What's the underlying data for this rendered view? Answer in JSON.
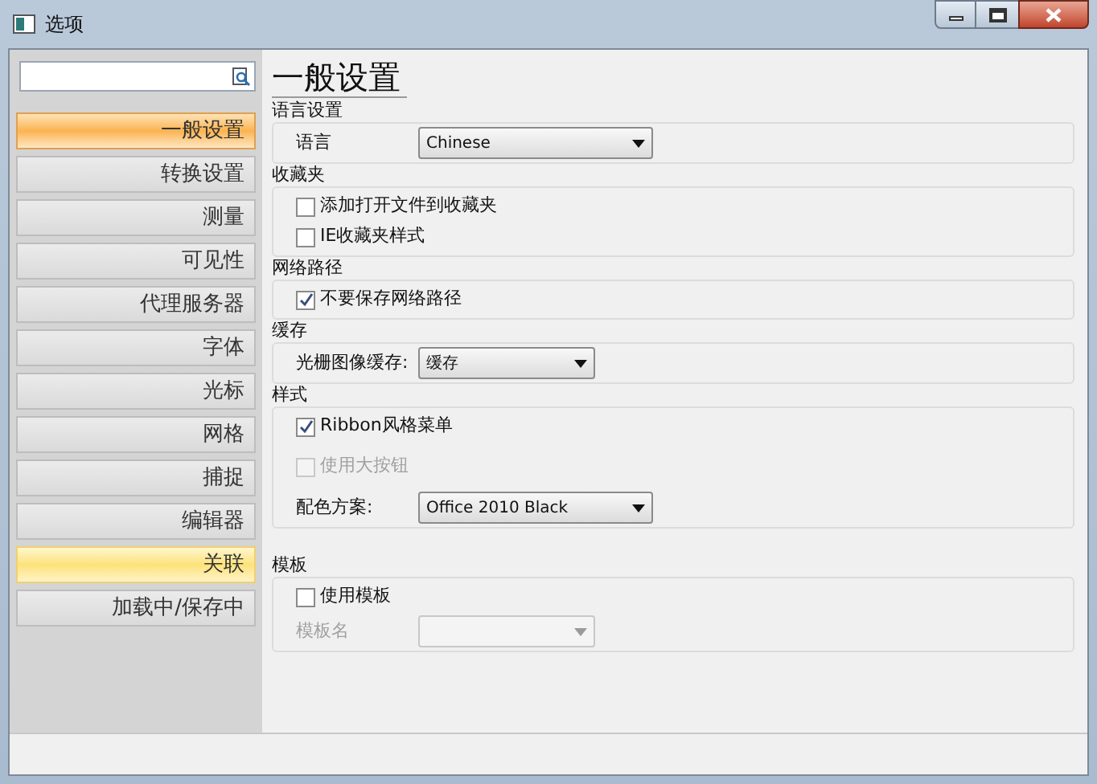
{
  "window": {
    "title": "选项"
  },
  "sidebar": {
    "items": [
      {
        "label": "一般设置",
        "selected": true,
        "hovered": false
      },
      {
        "label": "转换设置",
        "selected": false,
        "hovered": false
      },
      {
        "label": "测量",
        "selected": false,
        "hovered": false
      },
      {
        "label": "可见性",
        "selected": false,
        "hovered": false
      },
      {
        "label": "代理服务器",
        "selected": false,
        "hovered": false
      },
      {
        "label": "字体",
        "selected": false,
        "hovered": false
      },
      {
        "label": "光标",
        "selected": false,
        "hovered": false
      },
      {
        "label": "网格",
        "selected": false,
        "hovered": false
      },
      {
        "label": "捕捉",
        "selected": false,
        "hovered": false
      },
      {
        "label": "编辑器",
        "selected": false,
        "hovered": false
      },
      {
        "label": "关联",
        "selected": false,
        "hovered": true
      },
      {
        "label": "加载中/保存中",
        "selected": false,
        "hovered": false
      }
    ]
  },
  "page_title": "一般设置",
  "sections": [
    {
      "title": "语言设置",
      "items": [
        {
          "kind": "select",
          "label": "语言",
          "value": "Chinese",
          "disabled": false,
          "wide": true
        }
      ]
    },
    {
      "title": "收藏夹",
      "items": [
        {
          "kind": "checkbox",
          "label": "添加打开文件到收藏夹",
          "checked": false,
          "disabled": false
        },
        {
          "kind": "checkbox",
          "label": "IE收藏夹样式",
          "checked": false,
          "disabled": false
        }
      ]
    },
    {
      "title": "网络路径",
      "items": [
        {
          "kind": "checkbox",
          "label": "不要保存网络路径",
          "checked": true,
          "disabled": false
        }
      ]
    },
    {
      "title": "缓存",
      "items": [
        {
          "kind": "select",
          "label": "光栅图像缓存:",
          "value": "缓存",
          "disabled": false,
          "wide": false
        }
      ]
    },
    {
      "title": "样式",
      "items": [
        {
          "kind": "checkbox",
          "label": "Ribbon风格菜单",
          "checked": true,
          "disabled": false
        },
        {
          "kind": "checkbox",
          "label": "使用大按钮",
          "checked": false,
          "disabled": true
        },
        {
          "kind": "select",
          "label": "配色方案:",
          "value": "Office 2010 Black",
          "disabled": false,
          "wide": true
        }
      ]
    },
    {
      "title": "模板",
      "items": [
        {
          "kind": "checkbox",
          "label": "使用模板",
          "checked": false,
          "disabled": false
        },
        {
          "kind": "select",
          "label": "模板名",
          "disabled": true,
          "wide": false
        }
      ]
    }
  ]
}
